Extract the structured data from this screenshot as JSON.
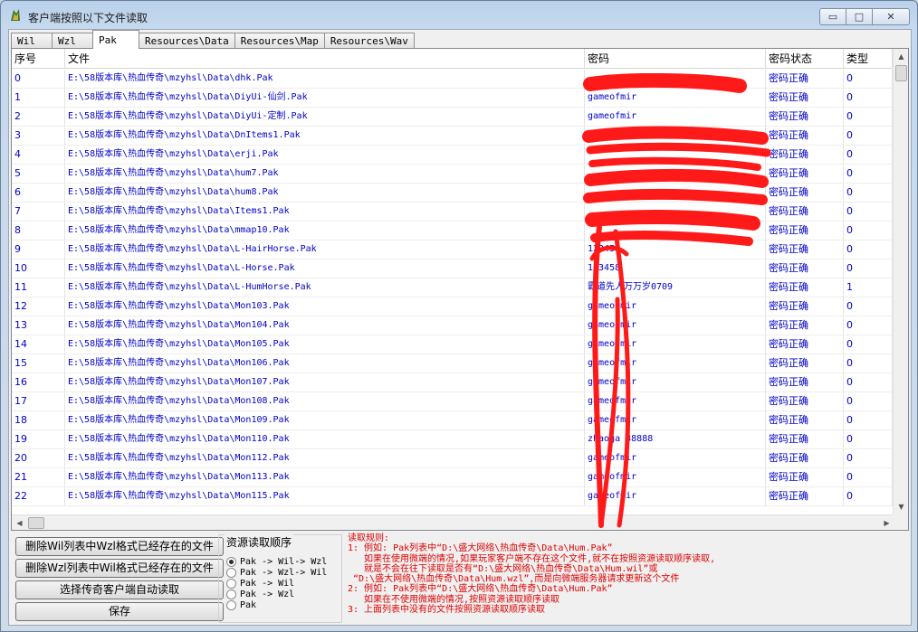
{
  "window": {
    "title": "客户端按照以下文件读取",
    "controls": [
      "minimize",
      "maximize",
      "close"
    ]
  },
  "tabs": [
    {
      "label": "Wil",
      "active": false
    },
    {
      "label": "Wzl",
      "active": false
    },
    {
      "label": "Pak",
      "active": true
    },
    {
      "label": "Resources\\Data",
      "active": false
    },
    {
      "label": "Resources\\Map",
      "active": false
    },
    {
      "label": "Resources\\Wav",
      "active": false
    }
  ],
  "table": {
    "headers": [
      "序号",
      "文件",
      "密码",
      "密码状态",
      "类型"
    ],
    "rows": [
      {
        "idx": "0",
        "file": "E:\\58版本库\\热血传奇\\mzyhsl\\Data\\dhk.Pak",
        "password": "",
        "status": "密码正确",
        "type": "0"
      },
      {
        "idx": "1",
        "file": "E:\\58版本库\\热血传奇\\mzyhsl\\Data\\DiyUi-仙剑.Pak",
        "password": "gameofmir",
        "status": "密码正确",
        "type": "0"
      },
      {
        "idx": "2",
        "file": "E:\\58版本库\\热血传奇\\mzyhsl\\Data\\DiyUi-定制.Pak",
        "password": "gameofmir",
        "status": "密码正确",
        "type": "0"
      },
      {
        "idx": "3",
        "file": "E:\\58版本库\\热血传奇\\mzyhsl\\Data\\DnItems1.Pak",
        "password": "",
        "status": "密码正确",
        "type": "0"
      },
      {
        "idx": "4",
        "file": "E:\\58版本库\\热血传奇\\mzyhsl\\Data\\erji.Pak",
        "password": "",
        "status": "密码正确",
        "type": "0"
      },
      {
        "idx": "5",
        "file": "E:\\58版本库\\热血传奇\\mzyhsl\\Data\\hum7.Pak",
        "password": "",
        "status": "密码正确",
        "type": "0"
      },
      {
        "idx": "6",
        "file": "E:\\58版本库\\热血传奇\\mzyhsl\\Data\\hum8.Pak",
        "password": "",
        "status": "密码正确",
        "type": "0"
      },
      {
        "idx": "7",
        "file": "E:\\58版本库\\热血传奇\\mzyhsl\\Data\\Items1.Pak",
        "password": "",
        "status": "密码正确",
        "type": "0"
      },
      {
        "idx": "8",
        "file": "E:\\58版本库\\热血传奇\\mzyhsl\\Data\\mmap10.Pak",
        "password": "",
        "status": "密码正确",
        "type": "0"
      },
      {
        "idx": "9",
        "file": "E:\\58版本库\\热血传奇\\mzyhsl\\Data\\L-HairHorse.Pak",
        "password": "123458",
        "status": "密码正确",
        "type": "0"
      },
      {
        "idx": "10",
        "file": "E:\\58版本库\\热血传奇\\mzyhsl\\Data\\L-Horse.Pak",
        "password": "123458",
        "status": "密码正确",
        "type": "0"
      },
      {
        "idx": "11",
        "file": "E:\\58版本库\\热血传奇\\mzyhsl\\Data\\L-HumHorse.Pak",
        "password": "霸道先人万万岁0709",
        "status": "密码正确",
        "type": "1"
      },
      {
        "idx": "12",
        "file": "E:\\58版本库\\热血传奇\\mzyhsl\\Data\\Mon103.Pak",
        "password": "gameofmir",
        "status": "密码正确",
        "type": "0"
      },
      {
        "idx": "13",
        "file": "E:\\58版本库\\热血传奇\\mzyhsl\\Data\\Mon104.Pak",
        "password": "gameofmir",
        "status": "密码正确",
        "type": "0"
      },
      {
        "idx": "14",
        "file": "E:\\58版本库\\热血传奇\\mzyhsl\\Data\\Mon105.Pak",
        "password": "gameofmir",
        "status": "密码正确",
        "type": "0"
      },
      {
        "idx": "15",
        "file": "E:\\58版本库\\热血传奇\\mzyhsl\\Data\\Mon106.Pak",
        "password": "gameofmir",
        "status": "密码正确",
        "type": "0"
      },
      {
        "idx": "16",
        "file": "E:\\58版本库\\热血传奇\\mzyhsl\\Data\\Mon107.Pak",
        "password": "gameofmir",
        "status": "密码正确",
        "type": "0"
      },
      {
        "idx": "17",
        "file": "E:\\58版本库\\热血传奇\\mzyhsl\\Data\\Mon108.Pak",
        "password": "gameofmir",
        "status": "密码正确",
        "type": "0"
      },
      {
        "idx": "18",
        "file": "E:\\58版本库\\热血传奇\\mzyhsl\\Data\\Mon109.Pak",
        "password": "gameofmir",
        "status": "密码正确",
        "type": "0"
      },
      {
        "idx": "19",
        "file": "E:\\58版本库\\热血传奇\\mzyhsl\\Data\\Mon110.Pak",
        "password": "zhaoga 38888",
        "status": "密码正确",
        "type": "0"
      },
      {
        "idx": "20",
        "file": "E:\\58版本库\\热血传奇\\mzyhsl\\Data\\Mon112.Pak",
        "password": "gameofmir",
        "status": "密码正确",
        "type": "0"
      },
      {
        "idx": "21",
        "file": "E:\\58版本库\\热血传奇\\mzyhsl\\Data\\Mon113.Pak",
        "password": "gameofmir",
        "status": "密码正确",
        "type": "0"
      },
      {
        "idx": "22",
        "file": "E:\\58版本库\\热血传奇\\mzyhsl\\Data\\Mon115.Pak",
        "password": "gameofmir",
        "status": "密码正确",
        "type": "0"
      }
    ]
  },
  "buttons": {
    "delete_wil": "删除Wil列表中Wzl格式已经存在的文件",
    "delete_wzl": "删除Wzl列表中Wil格式已经存在的文件",
    "auto_read": "选择传奇客户端自动读取",
    "save": "保存"
  },
  "resource_order": {
    "title": "资源读取顺序",
    "selected_index": 0,
    "options": [
      "Pak -> Wil-> Wzl",
      "Pak -> Wzl-> Wil",
      "Pak -> Wil",
      "Pak -> Wzl",
      "Pak"
    ]
  },
  "rules": {
    "lines": [
      "读取规则:",
      "1: 例如: Pak列表中“D:\\盛大网络\\热血传奇\\Data\\Hum.Pak”",
      "   如果在使用微端的情况,如果玩家客户端不存在这个文件,就不在按照资源读取顺序读取,",
      "   就是不会在往下读取是否有“D:\\盛大网络\\热血传奇\\Data\\Hum.wil”或",
      " “D:\\盛大网络\\热血传奇\\Data\\Hum.wzl”,而是向微端服务器请求更新这个文件",
      "2: 例如: Pak列表中“D:\\盛大网络\\热血传奇\\Data\\Hum.Pak”",
      "   如果在不使用微端的情况,按照资源读取顺序读取",
      "3: 上面列表中没有的文件按照资源读取顺序读取"
    ]
  },
  "colors": {
    "link_text": "#0000cc",
    "rules_text": "#e00000",
    "redaction": "#ff1a1a"
  }
}
